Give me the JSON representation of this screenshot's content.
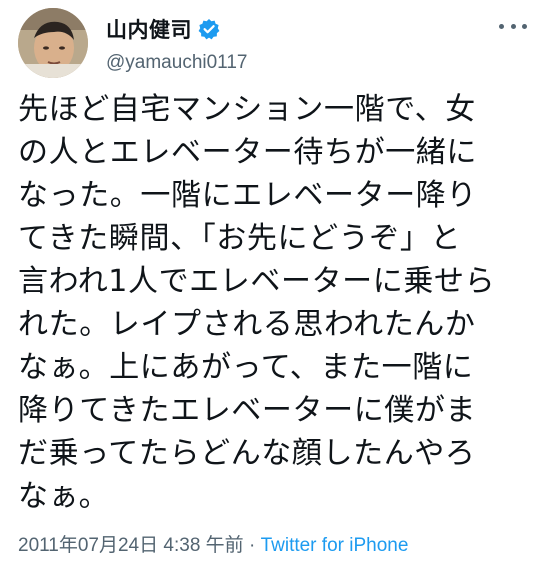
{
  "author": {
    "display_name": "山内健司",
    "handle": "@yamauchi0117",
    "verified": true,
    "avatar_icon": "profile-photo"
  },
  "tweet": {
    "text": "先ほど自宅マンション一階で、女\nの人とエレベーター待ちが一緒に\nなった。一階にエレベーター降り\nてきた瞬間、「お先にどうぞ」と\n言われ1人でエレベーターに乗せら\nれた。レイプされる思われたんか\nなぁ。上にあがって、また一階に\n降りてきたエレベーターに僕がま\nだ乗ってたらどんな顔したんやろ\nなぁ。",
    "timestamp": "2011年07月24日 4:38 午前",
    "separator": " · ",
    "source": "Twitter for iPhone"
  },
  "colors": {
    "text": "#0f1419",
    "secondary": "#536471",
    "accent": "#1d9bf0"
  }
}
